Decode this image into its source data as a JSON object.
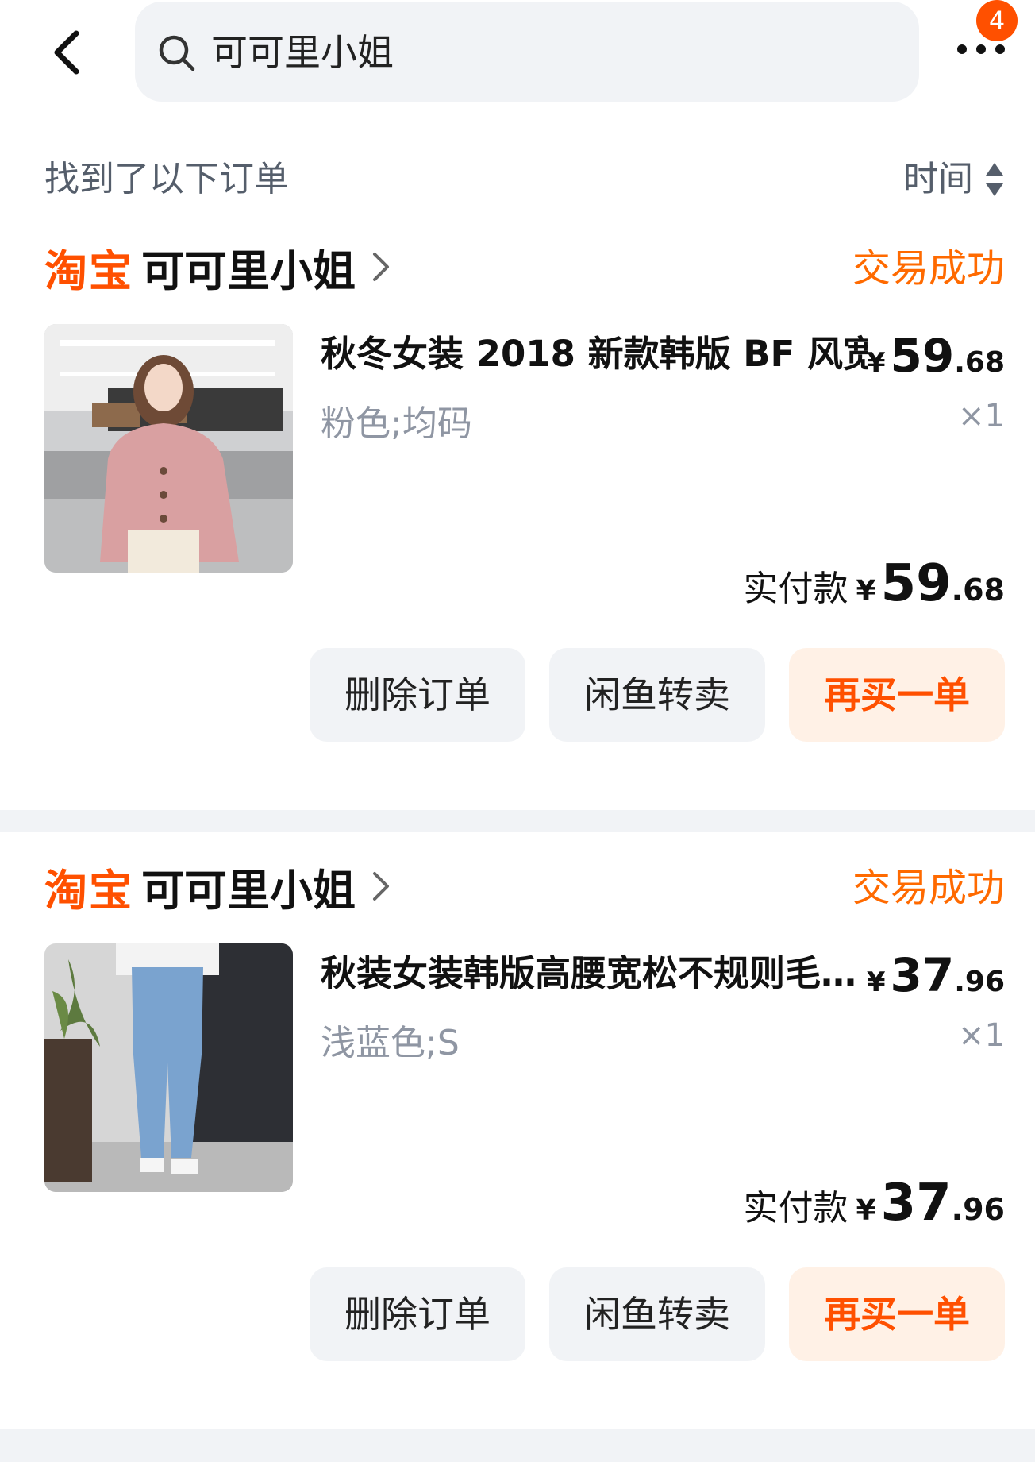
{
  "header": {
    "search_query": "可可里小姐",
    "more_badge": "4"
  },
  "results": {
    "label": "找到了以下订单",
    "sort_label": "时间"
  },
  "orders": [
    {
      "platform": "淘宝",
      "shop": "可可里小姐",
      "status": "交易成功",
      "title": "秋冬女装 2018 新款韩版 BF 风宽…",
      "unit_price": {
        "currency": "¥",
        "integer": "59",
        "decimal": ".68"
      },
      "sku": "粉色;均码",
      "quantity": "×1",
      "paid": {
        "label": "实付款",
        "currency": "¥",
        "integer": "59",
        "decimal": ".68"
      },
      "actions": {
        "delete": "删除订单",
        "resell": "闲鱼转卖",
        "rebuy": "再买一单"
      }
    },
    {
      "platform": "淘宝",
      "shop": "可可里小姐",
      "status": "交易成功",
      "title": "秋装女装韩版高腰宽松不规则毛…",
      "unit_price": {
        "currency": "¥",
        "integer": "37",
        "decimal": ".96"
      },
      "sku": "浅蓝色;S",
      "quantity": "×1",
      "paid": {
        "label": "实付款",
        "currency": "¥",
        "integer": "37",
        "decimal": ".96"
      },
      "actions": {
        "delete": "删除订单",
        "resell": "闲鱼转卖",
        "rebuy": "再买一单"
      }
    }
  ],
  "colors": {
    "accent": "#ff5000",
    "status": "#ff6a00",
    "button_bg": "#f1f3f6",
    "primary_button_bg": "#fff1e6",
    "muted_text": "#8f96a3"
  }
}
